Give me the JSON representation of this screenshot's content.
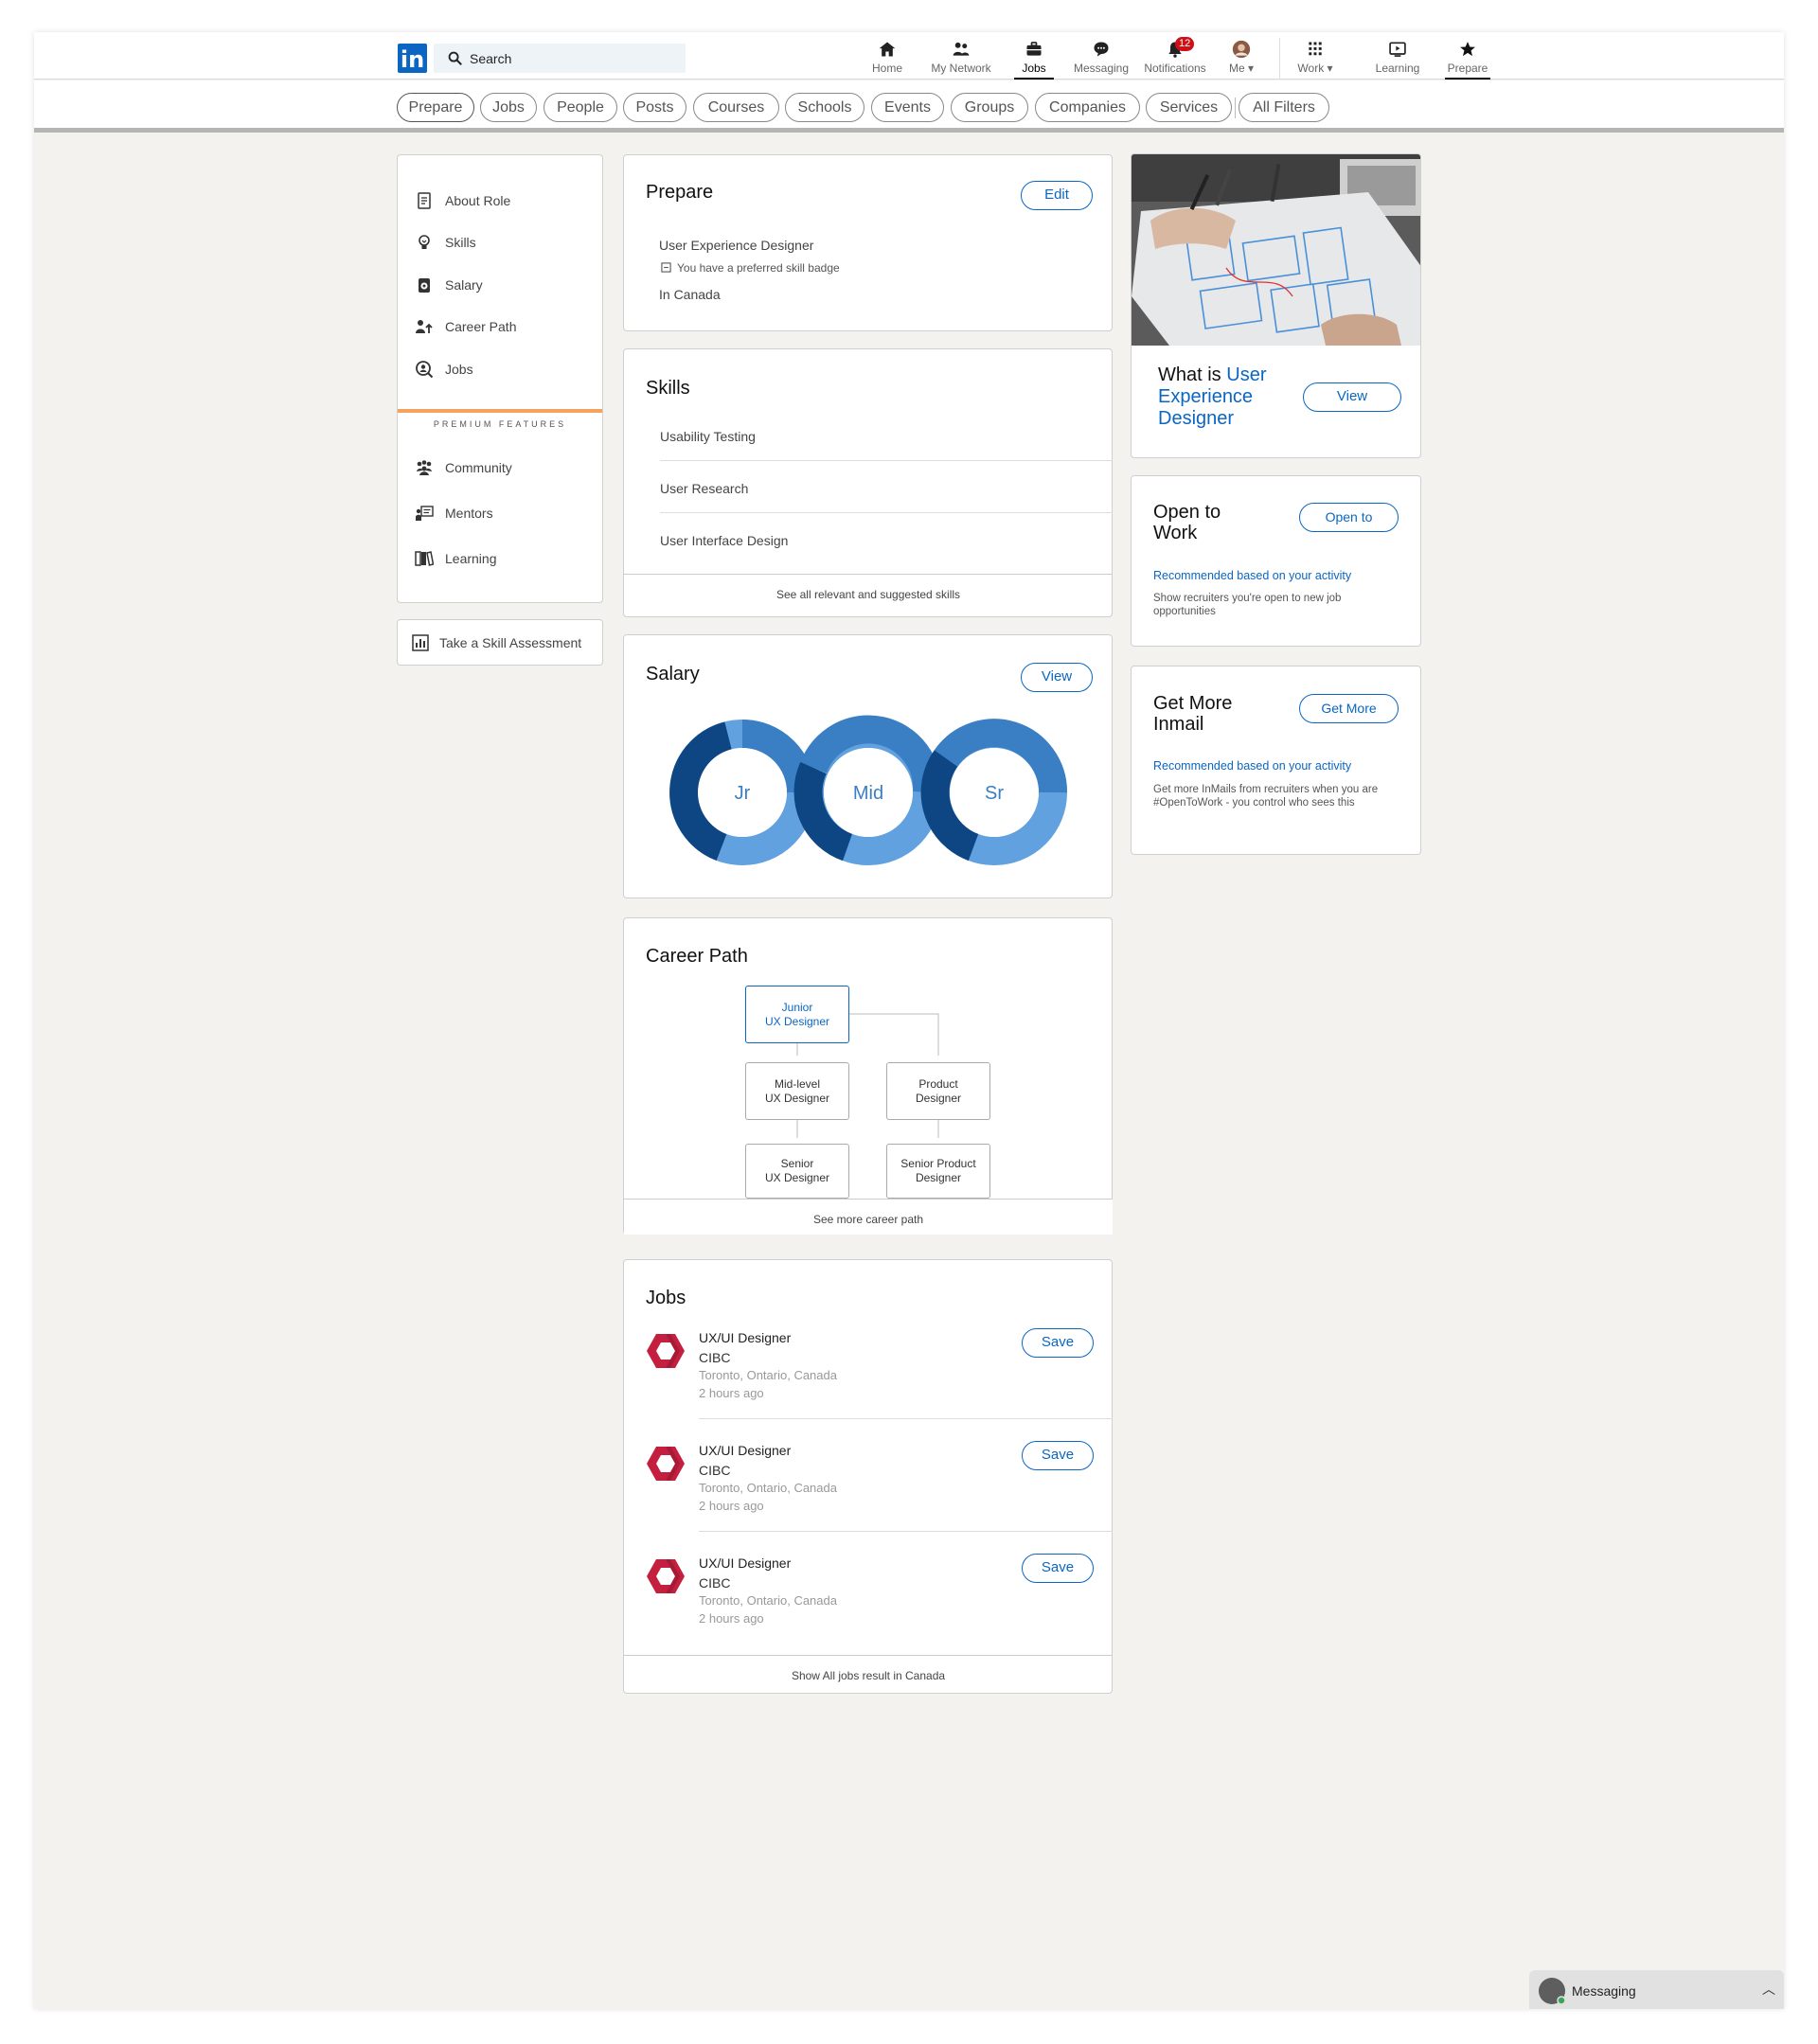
{
  "header": {
    "logo_text": "in",
    "search_placeholder": "Search",
    "nav": [
      {
        "key": "home",
        "label": "Home",
        "icon": "home-icon"
      },
      {
        "key": "network",
        "label": "My Network",
        "icon": "people-icon"
      },
      {
        "key": "jobs",
        "label": "Jobs",
        "icon": "briefcase-icon"
      },
      {
        "key": "messaging",
        "label": "Messaging",
        "icon": "chat-icon"
      },
      {
        "key": "notifications",
        "label": "Notifications",
        "icon": "bell-icon",
        "badge": "12"
      },
      {
        "key": "me",
        "label": "Me",
        "icon": "avatar-icon"
      },
      {
        "key": "work",
        "label": "Work",
        "icon": "grid-icon"
      },
      {
        "key": "learning",
        "label": "Learning",
        "icon": "play-icon"
      },
      {
        "key": "prepare",
        "label": "Prepare",
        "icon": "star-icon"
      }
    ]
  },
  "filters": [
    "Prepare",
    "Jobs",
    "People",
    "Posts",
    "Courses",
    "Schools",
    "Events",
    "Groups",
    "Companies",
    "Services",
    "All Filters"
  ],
  "sidebar": {
    "items": [
      {
        "label": "About Role",
        "icon": "document-icon"
      },
      {
        "label": "Skills",
        "icon": "lightbulb-icon"
      },
      {
        "label": "Salary",
        "icon": "money-icon"
      },
      {
        "label": "Career Path",
        "icon": "career-icon"
      },
      {
        "label": "Jobs",
        "icon": "search-person-icon"
      }
    ],
    "premium_label": "PREMIUM FEATURES",
    "premium_items": [
      {
        "label": "Community",
        "icon": "community-icon"
      },
      {
        "label": "Mentors",
        "icon": "mentor-icon"
      },
      {
        "label": "Learning",
        "icon": "book-icon"
      }
    ],
    "assessment_label": "Take a Skill Assessment",
    "accent_color": "#f5a35c"
  },
  "prepare": {
    "title": "Prepare",
    "edit_label": "Edit",
    "role": "User Experience Designer",
    "badge_note": "You have a preferred skill badge",
    "location": "In Canada"
  },
  "skills": {
    "title": "Skills",
    "items": [
      "Usability Testing",
      "User Research",
      "User Interface Design"
    ],
    "footer": "See all relevant and suggested skills"
  },
  "salary": {
    "title": "Salary",
    "view_label": "View",
    "levels": [
      "Jr",
      "Mid",
      "Sr"
    ],
    "colors": [
      "#0d4683",
      "#3a7ec4",
      "#62a1e0"
    ]
  },
  "career": {
    "title": "Career Path",
    "nodes": {
      "junior": "Junior\nUX Designer",
      "mid": "Mid-level\nUX Designer",
      "product": "Product\nDesigner",
      "senior": "Senior\nUX Designer",
      "senior_product": "Senior Product\nDesigner"
    },
    "footer": "See more career path"
  },
  "jobs": {
    "title": "Jobs",
    "save_label": "Save",
    "items": [
      {
        "title": "UX/UI Designer",
        "company": "CIBC",
        "location": "Toronto, Ontario, Canada",
        "time": "2 hours ago"
      },
      {
        "title": "UX/UI Designer",
        "company": "CIBC",
        "location": "Toronto, Ontario, Canada",
        "time": "2 hours ago"
      },
      {
        "title": "UX/UI Designer",
        "company": "CIBC",
        "location": "Toronto, Ontario, Canada",
        "time": "2 hours ago"
      }
    ],
    "footer": "Show All jobs result in Canada",
    "brand_color": "#c41f3e"
  },
  "right": {
    "what_is_prefix": "What is ",
    "what_is_role": "User Experience Designer",
    "what_is_view": "View",
    "open_title": "Open to Work",
    "open_btn": "Open to",
    "open_rec": "Recommended based on your activity",
    "open_desc": "Show recruiters you're open to new job opportunities",
    "inmail_title": "Get More Inmail",
    "inmail_btn": "Get More",
    "inmail_rec": "Recommended based on your activity",
    "inmail_desc": "Get more InMails from recruiters when you are #OpenToWork -  you control who sees this"
  },
  "messaging": {
    "label": "Messaging"
  }
}
